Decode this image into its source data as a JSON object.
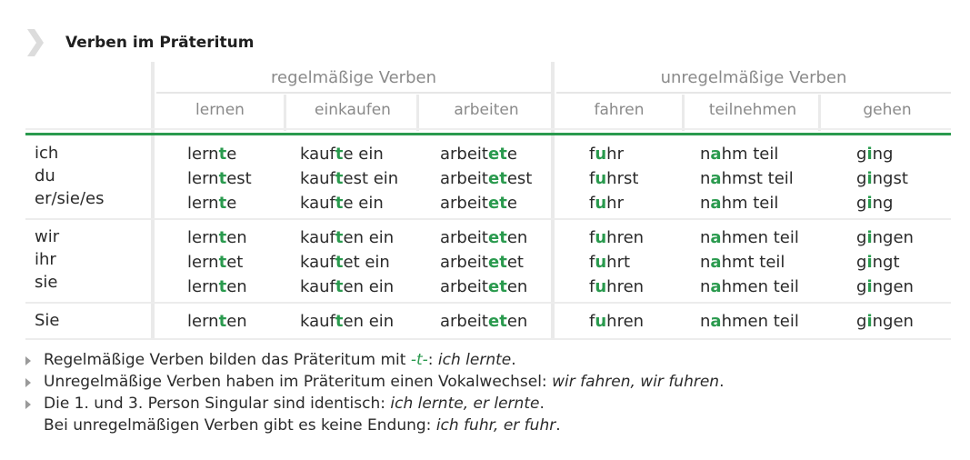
{
  "title": "Verben im Präteritum",
  "icon": "chevron-right-icon",
  "colors": {
    "accent": "#2a9a4e",
    "header_text": "#8a8a8a",
    "separator": "#e6e6e6"
  },
  "groups": [
    {
      "label": "regelmäßige Verben"
    },
    {
      "label": "unregelmäßige Verben"
    }
  ],
  "columns": [
    "lernen",
    "einkaufen",
    "arbeiten",
    "fahren",
    "teilnehmen",
    "gehen"
  ],
  "pronoun_blocks": [
    [
      "ich",
      "du",
      "er/sie/es"
    ],
    [
      "wir",
      "ihr",
      "sie"
    ],
    [
      "Sie"
    ]
  ],
  "forms": [
    [
      [
        [
          "lern",
          "t",
          "e"
        ],
        [
          "kauf",
          "t",
          "e ein"
        ],
        [
          "arbeit",
          "et",
          "e"
        ],
        [
          "f",
          "u",
          "hr"
        ],
        [
          "n",
          "a",
          "hm teil"
        ],
        [
          "g",
          "i",
          "ng"
        ]
      ],
      [
        [
          "lern",
          "t",
          "est"
        ],
        [
          "kauf",
          "t",
          "est ein"
        ],
        [
          "arbeit",
          "et",
          "est"
        ],
        [
          "f",
          "u",
          "hrst"
        ],
        [
          "n",
          "a",
          "hmst teil"
        ],
        [
          "g",
          "i",
          "ngst"
        ]
      ],
      [
        [
          "lern",
          "t",
          "e"
        ],
        [
          "kauf",
          "t",
          "e ein"
        ],
        [
          "arbeit",
          "et",
          "e"
        ],
        [
          "f",
          "u",
          "hr"
        ],
        [
          "n",
          "a",
          "hm teil"
        ],
        [
          "g",
          "i",
          "ng"
        ]
      ]
    ],
    [
      [
        [
          "lern",
          "t",
          "en"
        ],
        [
          "kauf",
          "t",
          "en ein"
        ],
        [
          "arbeit",
          "et",
          "en"
        ],
        [
          "f",
          "u",
          "hren"
        ],
        [
          "n",
          "a",
          "hmen teil"
        ],
        [
          "g",
          "i",
          "ngen"
        ]
      ],
      [
        [
          "lern",
          "t",
          "et"
        ],
        [
          "kauf",
          "t",
          "et ein"
        ],
        [
          "arbeit",
          "et",
          "et"
        ],
        [
          "f",
          "u",
          "hrt"
        ],
        [
          "n",
          "a",
          "hmt teil"
        ],
        [
          "g",
          "i",
          "ngt"
        ]
      ],
      [
        [
          "lern",
          "t",
          "en"
        ],
        [
          "kauf",
          "t",
          "en ein"
        ],
        [
          "arbeit",
          "et",
          "en"
        ],
        [
          "f",
          "u",
          "hren"
        ],
        [
          "n",
          "a",
          "hmen teil"
        ],
        [
          "g",
          "i",
          "ngen"
        ]
      ]
    ],
    [
      [
        [
          "lern",
          "t",
          "en"
        ],
        [
          "kauf",
          "t",
          "en ein"
        ],
        [
          "arbeit",
          "et",
          "en"
        ],
        [
          "f",
          "u",
          "hren"
        ],
        [
          "n",
          "a",
          "hmen teil"
        ],
        [
          "g",
          "i",
          "ngen"
        ]
      ]
    ]
  ],
  "notes": [
    {
      "parts": [
        {
          "t": "Regelmäßige Verben bilden das Präteritum mit ",
          "s": "n"
        },
        {
          "t": "-t-",
          "s": "g"
        },
        {
          "t": ": ",
          "s": "n"
        },
        {
          "t": "ich lernte",
          "s": "i"
        },
        {
          "t": ".",
          "s": "n"
        }
      ],
      "bullet": true
    },
    {
      "parts": [
        {
          "t": "Unregelmäßige Verben haben im Präteritum einen Vokalwechsel: ",
          "s": "n"
        },
        {
          "t": "wir fahren, wir fuhren",
          "s": "i"
        },
        {
          "t": ".",
          "s": "n"
        }
      ],
      "bullet": true
    },
    {
      "parts": [
        {
          "t": "Die 1. und 3. Person Singular sind identisch: ",
          "s": "n"
        },
        {
          "t": "ich lernte, er lernte",
          "s": "i"
        },
        {
          "t": ".",
          "s": "n"
        }
      ],
      "bullet": true
    },
    {
      "parts": [
        {
          "t": "Bei unregelmäßigen Verben gibt es keine Endung: ",
          "s": "n"
        },
        {
          "t": "ich fuhr, er fuhr",
          "s": "i"
        },
        {
          "t": ".",
          "s": "n"
        }
      ],
      "bullet": false
    }
  ]
}
